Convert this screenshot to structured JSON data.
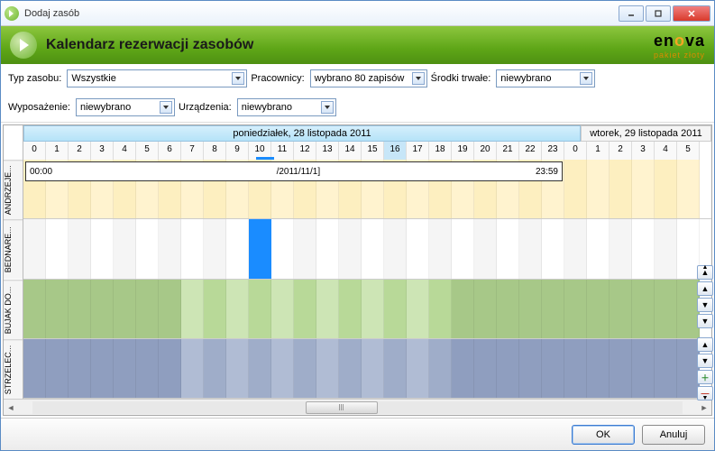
{
  "window": {
    "title": "Dodaj zasób"
  },
  "header": {
    "title": "Kalendarz rezerwacji zasobów",
    "brand": "en",
    "brand_o": "o",
    "brand_end": "va",
    "brand_sub": "pakiet złoty"
  },
  "filters": {
    "type_label": "Typ zasobu:",
    "type_value": "Wszystkie",
    "emp_label": "Pracownicy:",
    "emp_value": "wybrano 80 zapisów",
    "asset_label": "Środki trwałe:",
    "asset_value": "niewybrano",
    "equip_label": "Wyposażenie:",
    "equip_value": "niewybrano",
    "dev_label": "Urządzenia:",
    "dev_value": "niewybrano"
  },
  "days": {
    "d1": "poniedziałek, 28 listopada 2011",
    "d2": "wtorek, 29 listopada 2011"
  },
  "hours": [
    "0",
    "1",
    "2",
    "3",
    "4",
    "5",
    "6",
    "7",
    "8",
    "9",
    "10",
    "11",
    "12",
    "13",
    "14",
    "15",
    "16",
    "17",
    "18",
    "19",
    "20",
    "21",
    "22",
    "23",
    "0",
    "1",
    "2",
    "3",
    "4",
    "5"
  ],
  "highlight_hour_index": 16,
  "underline_hour_index": 10,
  "rows": {
    "labels": [
      "ANDRZEJE...",
      "BEDNARE...",
      "BUJAK DO...",
      "STRZELEC..."
    ],
    "event": {
      "start": "00:00",
      "mid": "/2011/11/1]",
      "end": "23:59"
    }
  },
  "footer": {
    "ok": "OK",
    "cancel": "Anuluj"
  }
}
